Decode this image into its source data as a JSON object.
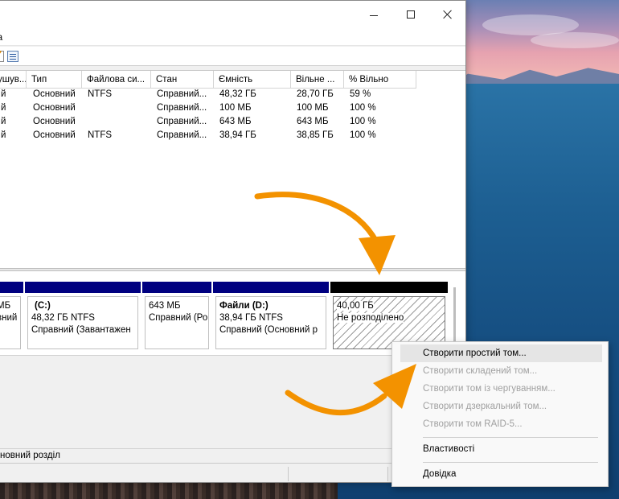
{
  "window": {
    "menu_item": "ка"
  },
  "volume_list": {
    "columns": [
      "ушув...",
      "Тип",
      "Файлова си...",
      "Стан",
      "Ємність",
      "Вільне ...",
      "% Вільно"
    ],
    "rows": [
      [
        "й",
        "Основний",
        "NTFS",
        "Справний...",
        "48,32 ГБ",
        "28,70 ГБ",
        "59 %"
      ],
      [
        "й",
        "Основний",
        "",
        "Справний...",
        "100 МБ",
        "100 МБ",
        "100 %"
      ],
      [
        "й",
        "Основний",
        "",
        "Справний...",
        "643 МБ",
        "643 МБ",
        "100 %"
      ],
      [
        "й",
        "Основний",
        "NTFS",
        "Справний...",
        "38,94 ГБ",
        "38,85 ГБ",
        "100 %"
      ]
    ]
  },
  "disk": {
    "partitions": [
      {
        "name": "",
        "size": "МБ",
        "status": "вний"
      },
      {
        "name": "(C:)",
        "size": "48,32 ГБ NTFS",
        "status": "Справний (Завантажен"
      },
      {
        "name": "",
        "size": "643 МБ",
        "status": "Справний (Ро"
      },
      {
        "name": "Файли (D:)",
        "size": "38,94 ГБ NTFS",
        "status": "Справний (Основний р"
      },
      {
        "name": "",
        "size": "40,00 ГБ",
        "status": "Не розподілено"
      }
    ]
  },
  "legend": {
    "text": "новний розділ"
  },
  "context_menu": {
    "items": [
      {
        "label": "Створити простий том...",
        "enabled": true
      },
      {
        "label": "Створити складений том...",
        "enabled": false
      },
      {
        "label": "Створити том із чергуванням...",
        "enabled": false
      },
      {
        "label": "Створити дзеркальний том...",
        "enabled": false
      },
      {
        "label": "Створити том RAID-5...",
        "enabled": false
      },
      {
        "label": "Властивості",
        "enabled": true
      },
      {
        "label": "Довідка",
        "enabled": true
      }
    ]
  },
  "colors": {
    "primary_partition_bar": "#000080",
    "unallocated_bar": "#000000",
    "annotation_arrow": "#f39200"
  },
  "icons": [
    "minimize-icon",
    "maximize-icon",
    "close-icon",
    "edit-icon",
    "properties-icon",
    "arrow-annotation"
  ]
}
